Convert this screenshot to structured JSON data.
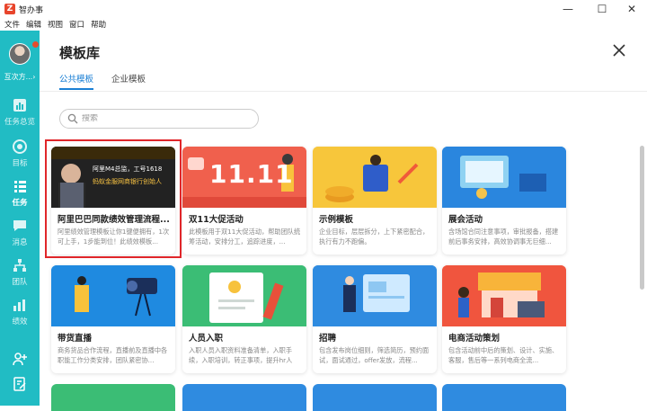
{
  "app": {
    "title": "智办事",
    "logo_letter": "Z"
  },
  "window_controls": {
    "minimize": "—",
    "maximize": "☐",
    "close": "✕"
  },
  "menu": [
    "文件",
    "编辑",
    "视图",
    "窗口",
    "帮助"
  ],
  "sidebar": {
    "company": "互次方...",
    "company_chevron": "›",
    "items": [
      {
        "label": "任务总览",
        "icon": "chart-icon"
      },
      {
        "label": "目标",
        "icon": "target-icon"
      },
      {
        "label": "任务",
        "icon": "task-list-icon",
        "active": true
      },
      {
        "label": "消息",
        "icon": "message-icon"
      },
      {
        "label": "团队",
        "icon": "team-icon"
      },
      {
        "label": "绩效",
        "icon": "performance-icon"
      }
    ],
    "bottom": [
      {
        "icon": "add-member-icon"
      },
      {
        "icon": "edit-note-icon"
      }
    ]
  },
  "page": {
    "title": "模板库",
    "tabs": [
      {
        "label": "公共模板",
        "active": true
      },
      {
        "label": "企业模板"
      }
    ],
    "search_placeholder": "搜索"
  },
  "cards": [
    {
      "title": "阿里巴巴同款绩效管理流程...",
      "desc": "阿里绩效管理模板让你1键便拥有，1次可上手，1步能到位！此绩效模板...",
      "thumb_text": [
        "阿里M4总监，工号1618",
        "蚂蚁金服网商银行创始人"
      ]
    },
    {
      "title": "双11大促活动",
      "desc": "此模板用于双11大促活动，帮助团队统筹活动，安排分工，追踪进度，...",
      "thumb_text": [
        "11.11"
      ]
    },
    {
      "title": "示例模板",
      "desc": "企业目标，层层拆分，上下紧密配合，执行有力不跑偏。"
    },
    {
      "title": "展会活动",
      "desc": "含场馆合同注意事项，审批报备，搭建前后事务安排，高效协调事无巨细..."
    },
    {
      "title": "带货直播",
      "desc": "商务货品合作流程，直播前及直播中各职能工作分类安排，团队紧密协..."
    },
    {
      "title": "人员入职",
      "desc": "入职人员入职资料准备清单，入职手续，入职培训，转正事项，提升hr人效..."
    },
    {
      "title": "招聘",
      "desc": "包含发布岗位细则，筛选简历，预约面试，面试通过，offer发放，流程..."
    },
    {
      "title": "电商活动策划",
      "desc": "包含活动前中后的策划、设计、实施、客服，售后等一系列电商全流..."
    }
  ],
  "colors": {
    "sidebar": "#21bcc4",
    "accent": "#1a7fd4",
    "selection": "#e0262a"
  }
}
